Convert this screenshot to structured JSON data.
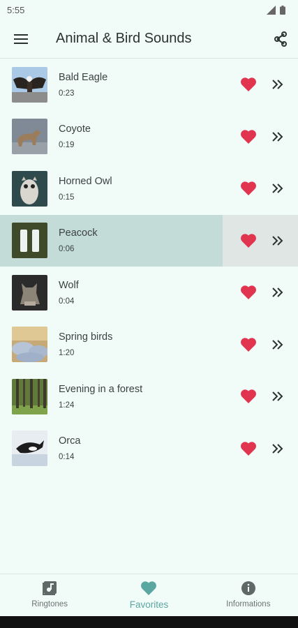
{
  "status_bar": {
    "time": "5:55"
  },
  "app_bar": {
    "title": "Animal & Bird Sounds"
  },
  "colors": {
    "accent": "#5aa6a1",
    "heart": "#e0344f",
    "selected_row": "#c4dcd7",
    "background": "#f1fbf8"
  },
  "sounds": [
    {
      "name": "Bald Eagle",
      "duration": "0:23",
      "thumb": "bald-eagle-photo"
    },
    {
      "name": "Coyote",
      "duration": "0:19",
      "thumb": "coyote-photo"
    },
    {
      "name": "Horned Owl",
      "duration": "0:15",
      "thumb": "horned-owl-photo"
    },
    {
      "name": "Peacock",
      "duration": "0:06",
      "thumb": "peacock-photo",
      "selected": true
    },
    {
      "name": "Wolf",
      "duration": "0:04",
      "thumb": "wolf-photo"
    },
    {
      "name": "Spring birds",
      "duration": "1:20",
      "thumb": "spring-birds-photo"
    },
    {
      "name": "Evening in a forest",
      "duration": "1:24",
      "thumb": "forest-photo"
    },
    {
      "name": "Orca",
      "duration": "0:14",
      "thumb": "orca-photo"
    }
  ],
  "bottom_nav": {
    "ringtones": "Ringtones",
    "favorites": "Favorites",
    "informations": "Informations",
    "active": "favorites"
  }
}
